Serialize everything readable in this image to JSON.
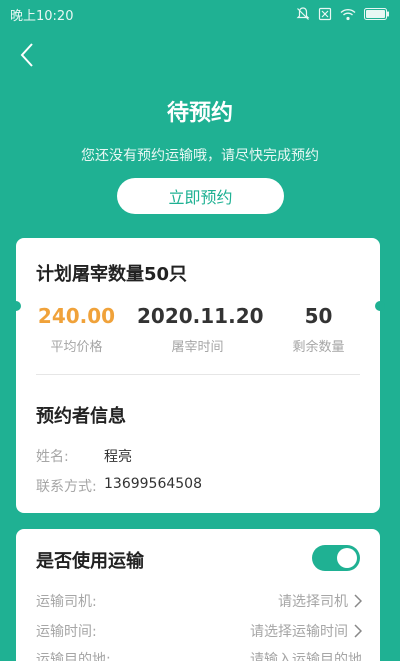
{
  "status_bar": {
    "time": "晚上10:20",
    "icons": [
      "mute-icon",
      "sim-off-icon",
      "wifi-icon",
      "battery-icon"
    ]
  },
  "header": {
    "back_icon": "chevron-left-icon",
    "title": "待预约",
    "subtitle": "您还没有预约运输哦，请尽快完成预约",
    "reserve_button": "立即预约"
  },
  "plan_card": {
    "title": "计划屠宰数量50只",
    "stats": [
      {
        "value": "240.00",
        "label": "平均价格"
      },
      {
        "value": "2020.11.20",
        "label": "屠宰时间"
      },
      {
        "value": "50",
        "label": "剩余数量"
      }
    ],
    "booker_title": "预约者信息",
    "booker": [
      {
        "label": "姓名:",
        "value": "程亮"
      },
      {
        "label": "联系方式:",
        "value": "13699564508"
      }
    ]
  },
  "transport_card": {
    "title": "是否使用运输",
    "toggle_on": true,
    "rows": [
      {
        "label": "运输司机:",
        "placeholder": "请选择司机"
      },
      {
        "label": "运输时间:",
        "placeholder": "请选择运输时间"
      },
      {
        "label": "运输目的地:",
        "placeholder": "请输入运输目的地"
      }
    ]
  },
  "colors": {
    "brand": "#1fb193",
    "price": "#f0a23a"
  }
}
